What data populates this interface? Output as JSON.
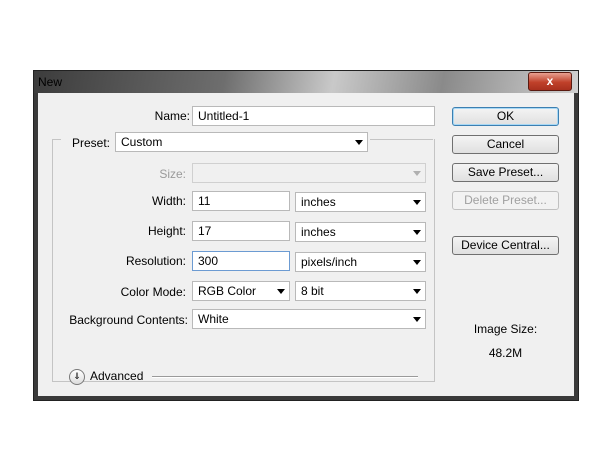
{
  "dialog": {
    "title": "New",
    "close_glyph": "x"
  },
  "form": {
    "name_label": "Name:",
    "name_value": "Untitled-1",
    "preset_label": "Preset:",
    "preset_value": "Custom",
    "size_label": "Size:",
    "size_value": "",
    "width_label": "Width:",
    "width_value": "11",
    "width_unit": "inches",
    "height_label": "Height:",
    "height_value": "17",
    "height_unit": "inches",
    "resolution_label": "Resolution:",
    "resolution_value": "300",
    "resolution_unit": "pixels/inch",
    "color_mode_label": "Color Mode:",
    "color_mode_value": "RGB Color",
    "bit_depth_value": "8 bit",
    "background_label": "Background Contents:",
    "background_value": "White",
    "advanced_label": "Advanced"
  },
  "buttons": {
    "ok": "OK",
    "cancel": "Cancel",
    "save_preset": "Save Preset...",
    "delete_preset": "Delete Preset...",
    "device_central": "Device Central..."
  },
  "info": {
    "image_size_label": "Image Size:",
    "image_size_value": "48.2M"
  },
  "icons": {
    "close": "close-icon",
    "dropdown": "chevron-down-icon",
    "advanced": "double-chevron-down-icon"
  }
}
